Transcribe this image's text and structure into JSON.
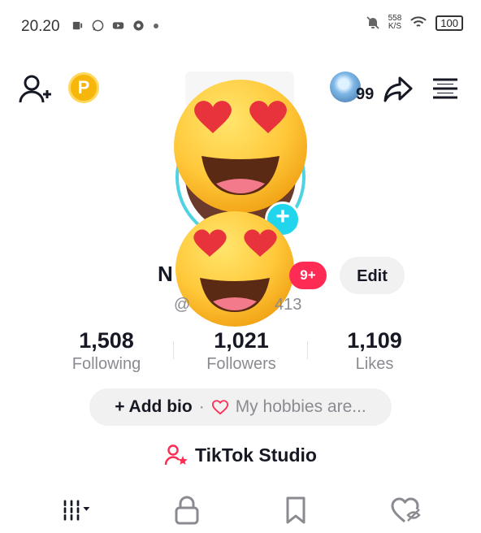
{
  "status_bar": {
    "time": "20.20",
    "net_speed_value": "558",
    "net_speed_unit": "K/S",
    "battery": "100"
  },
  "header": {
    "coin_letter": "P",
    "story_count": "99"
  },
  "profile": {
    "name_partial": "N",
    "notification_badge": "9+",
    "edit_label": "Edit",
    "handle_prefix": "@",
    "handle_suffix": "413"
  },
  "stats": [
    {
      "value": "1,508",
      "label": "Following"
    },
    {
      "value": "1,021",
      "label": "Followers"
    },
    {
      "value": "1,109",
      "label": "Likes"
    }
  ],
  "bio": {
    "add_label": "+ Add bio",
    "separator": "·",
    "hobby_placeholder": "My hobbies are..."
  },
  "studio": {
    "label": "TikTok Studio"
  },
  "colors": {
    "accent_red": "#fe2c55",
    "accent_cyan": "#20d5ec",
    "coin_gold": "#f6b60c"
  },
  "icons": {
    "add_friend": "add-friend-icon",
    "share": "share-icon",
    "menu": "menu-icon",
    "videos_tab": "grid-tab-icon",
    "private_tab": "lock-icon",
    "saved_tab": "bookmark-icon",
    "liked_tab": "hidden-heart-icon"
  }
}
